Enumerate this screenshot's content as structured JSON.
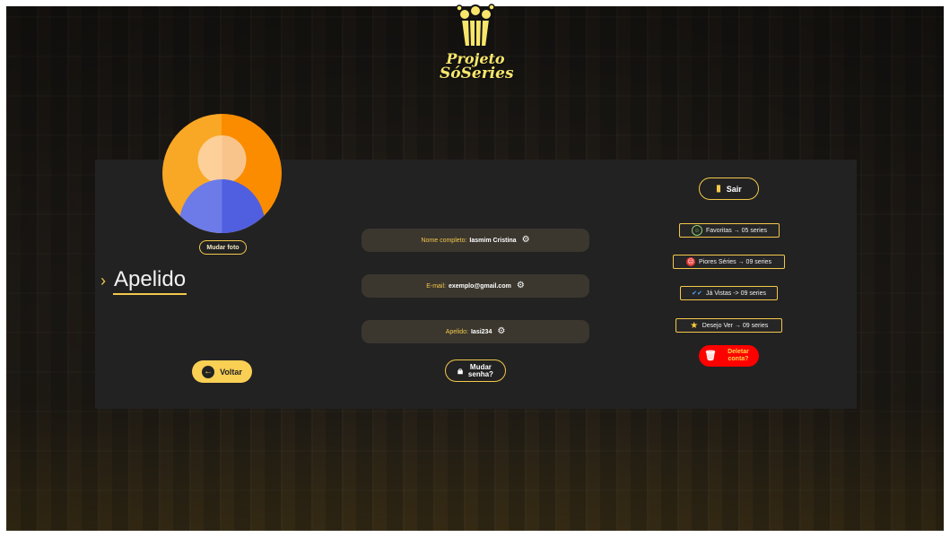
{
  "logo": {
    "line1": "Projeto",
    "line2": "SóSeries",
    "icon": "popcorn-icon"
  },
  "profile": {
    "change_photo_label": "Mudar foto",
    "nickname_heading": "Apelido",
    "avatar_colors": {
      "left": "#f9a825",
      "right": "#fb8c00",
      "head": "#fdd09a",
      "body_left": "#6c7be8",
      "body_right": "#4f5fe0"
    }
  },
  "fields": [
    {
      "label": "Nome completo:",
      "value": "Iasmim Cristina",
      "icon": "gear-icon"
    },
    {
      "label": "E-mail:",
      "value": "exemplo@gmail.com",
      "icon": "gear-icon"
    },
    {
      "label": "Apelido:",
      "value": "Iasi234",
      "icon": "gear-icon"
    }
  ],
  "buttons": {
    "back_label": "Voltar",
    "change_password_label": "Mudar senha?",
    "logout_label": "Sair",
    "delete_label": "Deletar conta?"
  },
  "stats": [
    {
      "label": "Favoritas → 05 series",
      "icon": "smile-icon"
    },
    {
      "label": "Piores Séries → 09 series",
      "icon": "sad-face-icon"
    },
    {
      "label": "Já Vistas -> 09 series",
      "icon": "double-check-icon"
    },
    {
      "label": "Desejo Ver → 09 series",
      "icon": "star-face-icon"
    }
  ],
  "colors": {
    "accent": "#f3c84b",
    "panel": "#222222",
    "field_bg": "#3b372e",
    "danger": "#ff0000"
  }
}
